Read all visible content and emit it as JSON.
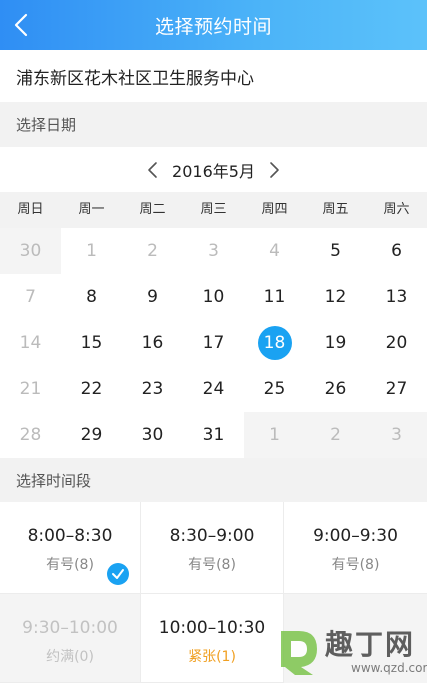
{
  "header": {
    "title": "选择预约时间"
  },
  "center": {
    "name": "浦东新区花木社区卫生服务中心"
  },
  "date_section": {
    "label": "选择日期"
  },
  "calendar": {
    "month_label": "2016年5月",
    "weekdays": [
      "周日",
      "周一",
      "周二",
      "周三",
      "周四",
      "周五",
      "周六"
    ],
    "weeks": [
      [
        {
          "d": "30",
          "s": "out"
        },
        {
          "d": "1",
          "s": "muted"
        },
        {
          "d": "2",
          "s": "muted"
        },
        {
          "d": "3",
          "s": "muted"
        },
        {
          "d": "4",
          "s": "muted"
        },
        {
          "d": "5",
          "s": "normal"
        },
        {
          "d": "6",
          "s": "normal"
        }
      ],
      [
        {
          "d": "7",
          "s": "muted"
        },
        {
          "d": "8",
          "s": "normal"
        },
        {
          "d": "9",
          "s": "normal"
        },
        {
          "d": "10",
          "s": "normal"
        },
        {
          "d": "11",
          "s": "normal"
        },
        {
          "d": "12",
          "s": "normal"
        },
        {
          "d": "13",
          "s": "normal"
        }
      ],
      [
        {
          "d": "14",
          "s": "muted"
        },
        {
          "d": "15",
          "s": "normal"
        },
        {
          "d": "16",
          "s": "normal"
        },
        {
          "d": "17",
          "s": "normal"
        },
        {
          "d": "18",
          "s": "selected"
        },
        {
          "d": "19",
          "s": "normal"
        },
        {
          "d": "20",
          "s": "normal"
        }
      ],
      [
        {
          "d": "21",
          "s": "muted"
        },
        {
          "d": "22",
          "s": "normal"
        },
        {
          "d": "23",
          "s": "normal"
        },
        {
          "d": "24",
          "s": "normal"
        },
        {
          "d": "25",
          "s": "normal"
        },
        {
          "d": "26",
          "s": "normal"
        },
        {
          "d": "27",
          "s": "normal"
        }
      ],
      [
        {
          "d": "28",
          "s": "muted"
        },
        {
          "d": "29",
          "s": "normal"
        },
        {
          "d": "30",
          "s": "normal"
        },
        {
          "d": "31",
          "s": "normal"
        },
        {
          "d": "1",
          "s": "out"
        },
        {
          "d": "2",
          "s": "out"
        },
        {
          "d": "3",
          "s": "out"
        }
      ]
    ],
    "selected_color": "#1aa2f2"
  },
  "time_section": {
    "label": "选择时间段"
  },
  "slots": [
    {
      "time": "8:00–8:30",
      "status": "有号(8)",
      "state": "selected"
    },
    {
      "time": "8:30–9:00",
      "status": "有号(8)",
      "state": "available"
    },
    {
      "time": "9:00–9:30",
      "status": "有号(8)",
      "state": "available"
    },
    {
      "time": "9:30–10:00",
      "status": "约满(0)",
      "state": "full"
    },
    {
      "time": "10:00–10:30",
      "status": "紧张(1)",
      "state": "tight"
    }
  ],
  "watermark": {
    "text": "趣丁网",
    "url": "www.qzd.com"
  },
  "icons": {
    "back": "chevron-left-icon",
    "prev": "chevron-left-icon",
    "next": "chevron-right-icon",
    "check": "check-icon"
  }
}
